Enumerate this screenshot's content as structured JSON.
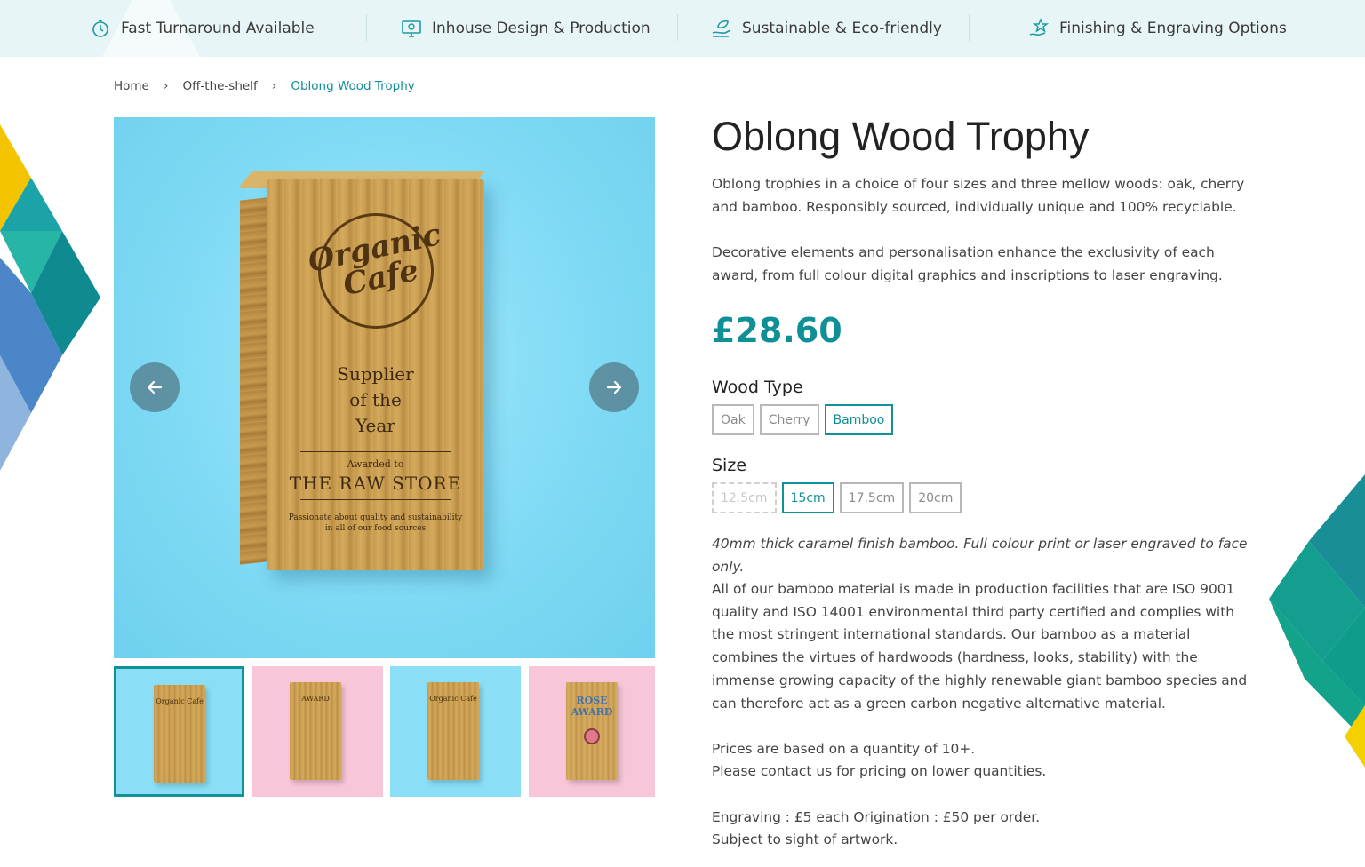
{
  "features": [
    {
      "label": "Fast Turnaround Available",
      "icon": "stopwatch-icon"
    },
    {
      "label": "Inhouse Design & Production",
      "icon": "monitor-design-icon"
    },
    {
      "label": "Sustainable & Eco-friendly",
      "icon": "eco-hand-icon"
    },
    {
      "label": "Finishing & Engraving Options",
      "icon": "star-hand-icon"
    }
  ],
  "breadcrumb": [
    {
      "label": "Home"
    },
    {
      "label": "Off-the-shelf"
    },
    {
      "label": "Oblong Wood Trophy"
    }
  ],
  "gallery": {
    "main_trophy": {
      "logo": "Organic Cafe",
      "logo_line1": "Organic",
      "logo_line2": "Cafe",
      "line1": "Supplier",
      "line2": "of the",
      "line3": "Year",
      "awarded": "Awarded to",
      "store": "THE RAW STORE",
      "tagline1": "Passionate about quality and sustainability",
      "tagline2": "in all of our food sources"
    },
    "prev_icon": "arrow-left-icon",
    "next_icon": "arrow-right-icon",
    "thumbnails": [
      {
        "bg": "#8adff7",
        "text": "Organic Cafe",
        "active": true
      },
      {
        "bg": "#f8c6d8",
        "text": "AWARD",
        "active": false
      },
      {
        "bg": "#8adff7",
        "text": "Organic Cafe",
        "active": false
      },
      {
        "bg": "#f8c6d8",
        "text": "ROSE AWARD",
        "active": false
      }
    ]
  },
  "product": {
    "title": "Oblong Wood Trophy",
    "intro1": "Oblong trophies in a choice of four sizes and three mellow woods: oak, cherry and bamboo. Responsibly sourced, individually unique and 100% recyclable.",
    "intro2": "Decorative elements and personalisation enhance the exclusivity of each award, from full colour digital graphics and inscriptions to laser engraving.",
    "price": "£28.60",
    "wood_label": "Wood Type",
    "wood_options": [
      {
        "label": "Oak",
        "state": "normal"
      },
      {
        "label": "Cherry",
        "state": "normal"
      },
      {
        "label": "Bamboo",
        "state": "selected"
      }
    ],
    "size_label": "Size",
    "size_options": [
      {
        "label": "12.5cm",
        "state": "disabled"
      },
      {
        "label": "15cm",
        "state": "selected"
      },
      {
        "label": "17.5cm",
        "state": "normal"
      },
      {
        "label": "20cm",
        "state": "normal"
      }
    ],
    "variant_note": "40mm thick caramel finish bamboo. Full colour print or laser engraved to face only.",
    "material_text": "All of our bamboo material is made in production facilities that are ISO 9001 quality and ISO 14001 environmental third party certified and complies with the most stringent international standards. Our bamboo as a material combines the virtues of hardwoods (hardness, looks, stability) with the immense growing capacity of the highly renewable giant bamboo species and can therefore act as a green carbon negative alternative material.",
    "pricing_line1": "Prices are based on a quantity of 10+.",
    "pricing_line2": "Please contact us for pricing on lower quantities.",
    "engraving_line1": "Engraving : £5 each Origination : £50 per order.",
    "engraving_line2": "Subject to sight of artwork."
  },
  "colors": {
    "accent": "#0f8f96",
    "topbar_bg": "#e8f5f6",
    "image_bg": "#7dd9f4"
  }
}
